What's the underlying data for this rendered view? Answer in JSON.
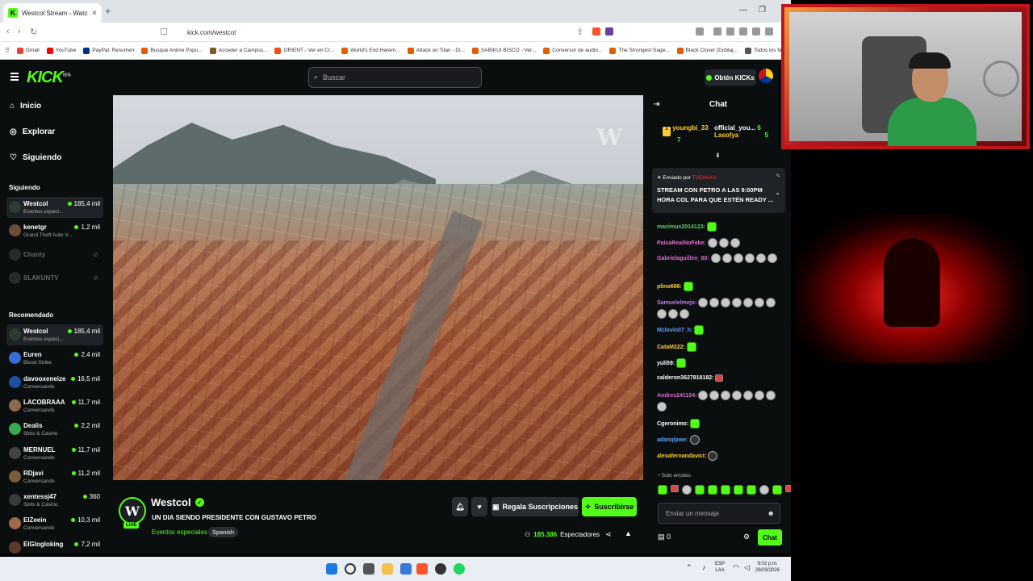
{
  "browser": {
    "tab_title": "Westcol Stream - Watch Live",
    "tab_close": "×",
    "new_tab": "+",
    "url": "kick.com/westcol",
    "bookmarks": [
      {
        "label": "Gmail",
        "color": "#ea4335"
      },
      {
        "label": "YouTube",
        "color": "#ff0000"
      },
      {
        "label": "PayPal: Resumen",
        "color": "#003087"
      },
      {
        "label": "Busque Anime Popu...",
        "color": "#e65c00"
      },
      {
        "label": "Acceder a Campus...",
        "color": "#7a5b2a"
      },
      {
        "label": "ORIENT - Ver en Cr...",
        "color": "#e94e1b"
      },
      {
        "label": "World's End Harem...",
        "color": "#e65c00"
      },
      {
        "label": "Attack on Titan - Di...",
        "color": "#e65c00"
      },
      {
        "label": "SABIKUI BISCO - Ver...",
        "color": "#e65c00"
      },
      {
        "label": "Conversor de audio...",
        "color": "#e65c00"
      },
      {
        "label": "The Strongest Sage...",
        "color": "#e65c00"
      },
      {
        "label": "Black Clover (Doblaj...",
        "color": "#e65c00"
      },
      {
        "label": "Todos los favorit",
        "color": "#555555"
      }
    ]
  },
  "kick": {
    "logo": "KICK",
    "logo_badge": "BETA",
    "search_placeholder": "Buscar",
    "get_kicks": "Obtén KICKs",
    "nav": [
      {
        "label": "Inicio",
        "icon": "home-icon"
      },
      {
        "label": "Explorar",
        "icon": "compass-icon"
      },
      {
        "label": "Siguiendo",
        "icon": "heart-icon"
      }
    ],
    "following_title": "Siguiendo",
    "following": [
      {
        "name": "Westcol",
        "category": "Eventos especi...",
        "viewers": "185,4 mil",
        "color": "#2d3b33"
      },
      {
        "name": "kenetgr",
        "category": "Grand Theft Auto V...",
        "viewers": "1,2 mil",
        "color": "#6b4e3a"
      },
      {
        "name": "Chanty",
        "category": "",
        "viewers": "",
        "color": "#555555"
      },
      {
        "name": "SLAKUNTV",
        "category": "",
        "viewers": "",
        "color": "#555555"
      }
    ],
    "recommended_title": "Recomendado",
    "recommended": [
      {
        "name": "Westcol",
        "category": "Eventos especi...",
        "viewers": "185,4 mil",
        "color": "#2d3b33"
      },
      {
        "name": "Euren",
        "category": "Blood Strike",
        "viewers": "2,4 mil",
        "color": "#3a6bd6"
      },
      {
        "name": "davooxeneize",
        "category": "Conversando",
        "viewers": "16,5 mil",
        "color": "#1b4fa0"
      },
      {
        "name": "LACOBRAAA",
        "category": "Conversando",
        "viewers": "11,7 mil",
        "color": "#8d6a4b"
      },
      {
        "name": "Dealis",
        "category": "Slots & Casino",
        "viewers": "2,2 mil",
        "color": "#3aa84f"
      },
      {
        "name": "MERNUEL",
        "category": "Conversando",
        "viewers": "11,7 mil",
        "color": "#444444"
      },
      {
        "name": "RDjavi",
        "category": "Conversando",
        "viewers": "11,2 mil",
        "color": "#7a5b3a"
      },
      {
        "name": "xentessj47",
        "category": "Slots & Casino",
        "viewers": "360",
        "color": "#3a3a3a"
      },
      {
        "name": "ElZeein",
        "category": "Conversando",
        "viewers": "10,3 mil",
        "color": "#a06a4a"
      },
      {
        "name": "ElGlogloking",
        "category": "",
        "viewers": "7,2 mil",
        "color": "#5a3a2a"
      }
    ],
    "stream": {
      "channel": "Westcol",
      "avatar_letter": "W",
      "live": "LIVE",
      "title": "UN DIA SIENDO PRESIDENTE CON GUSTAVO PETRO",
      "category": "Eventos especiales",
      "language": "Spanish",
      "gift_label": "Regala Suscripciones",
      "subscribe_label": "Suscribirse",
      "viewer_count": "185.386",
      "viewer_label": "Espectadores",
      "watermark": "W"
    },
    "chat": {
      "title": "Chat",
      "top_gifters": [
        {
          "name": "youngbi_33",
          "count": "7",
          "color": "#ffcc33"
        },
        {
          "name": "official_you...",
          "count": "6",
          "color": "#ffffff"
        },
        {
          "name": "Lasofya",
          "count": "5",
          "color": "#ffcc33"
        }
      ],
      "pinned_by": "Enviado por",
      "pinned_user": "TIXDINXA",
      "pinned_message": "STREAM CON PETRO A LAS 9:00PM HORA COL PARA QUE ESTÉN READY ...",
      "messages": [
        {
          "user": "maximus2014123:",
          "color": "#5bd06b",
          "emotes": "g"
        },
        {
          "user": "PaisaRealNoFake:",
          "color": "#e06ad0",
          "emotes": "ooo"
        },
        {
          "user": "Gabrielaguillen_80:",
          "color": "#e06ad0",
          "emotes": "oooooo"
        },
        {
          "user": "plino666:",
          "color": "#ffcc33",
          "emotes": "g"
        },
        {
          "user": "Samuelelmejo:",
          "color": "#c07bf0",
          "emotes": "oooooooooo"
        },
        {
          "user": "Mclovin07_h:",
          "color": "#5aa0ff",
          "emotes": "g"
        },
        {
          "user": "CataM222:",
          "color": "#ffcc33",
          "emotes": "g"
        },
        {
          "user": "yuli59:",
          "color": "#ffffff",
          "emotes": "g"
        },
        {
          "user": "calderon3627818182:",
          "color": "#ffffff",
          "emotes": "r"
        },
        {
          "user": "Andres241104:",
          "color": "#e06ad0",
          "emotes": "oooooooo"
        },
        {
          "user": "Cgeronimo:",
          "color": "#ffffff",
          "emotes": "g"
        },
        {
          "user": "adanqlpwe:",
          "color": "#5aa0ff",
          "emotes": "d"
        },
        {
          "user": "alexafernandavict:",
          "color": "#ffcc33",
          "emotes": "d"
        }
      ],
      "emote_only": "Solo emotes",
      "input_placeholder": "Enviar un mensaje",
      "kicks_count": "0",
      "send_label": "Chat"
    }
  },
  "taskbar": {
    "lang_top": "ESP",
    "lang_bottom": "LAA",
    "time": "9:02 p.m.",
    "date": "26/03/2026"
  }
}
